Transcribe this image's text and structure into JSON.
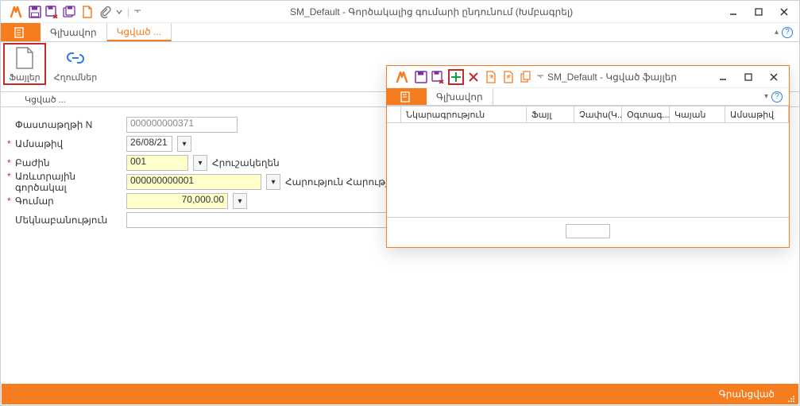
{
  "main": {
    "title": "SM_Default - Գործակալից գումարի ընդունում (Խմբագրել)",
    "tabs": {
      "tab1": "Գլխավոր",
      "tab2": "Կցված ..."
    },
    "ribbon": {
      "files": "Ֆայլեր",
      "links": "Հղումներ"
    },
    "section_label": "Կցված ...",
    "form": {
      "doc_no_label": "Փաստաթղթի N",
      "doc_no": "000000000371",
      "date_label": "Ամսաթիվ",
      "date": "26/08/21",
      "section_label": "Բաժին",
      "section_code": "001",
      "section_name": "Հրուշակեղեն",
      "agent_label": "Առևտրային գործակալ",
      "agent_code": "000000000001",
      "agent_name": "Հարություն Հարությունյան",
      "amount_label": "Գումար",
      "amount": "70,000.00",
      "comment_label": "Մեկնաբանություն",
      "comment": ""
    },
    "status": "Գրանցված"
  },
  "files": {
    "title": "SM_Default - Կցված ֆայլեր",
    "tab": "Գլխավոր",
    "cols": {
      "c1": "Նկարագրություն",
      "c2": "Ֆայլ",
      "c3": "Չափս(Կ...",
      "c4": "Օգտագ...",
      "c5": "Կայան",
      "c6": "Ամսաթիվ"
    }
  }
}
